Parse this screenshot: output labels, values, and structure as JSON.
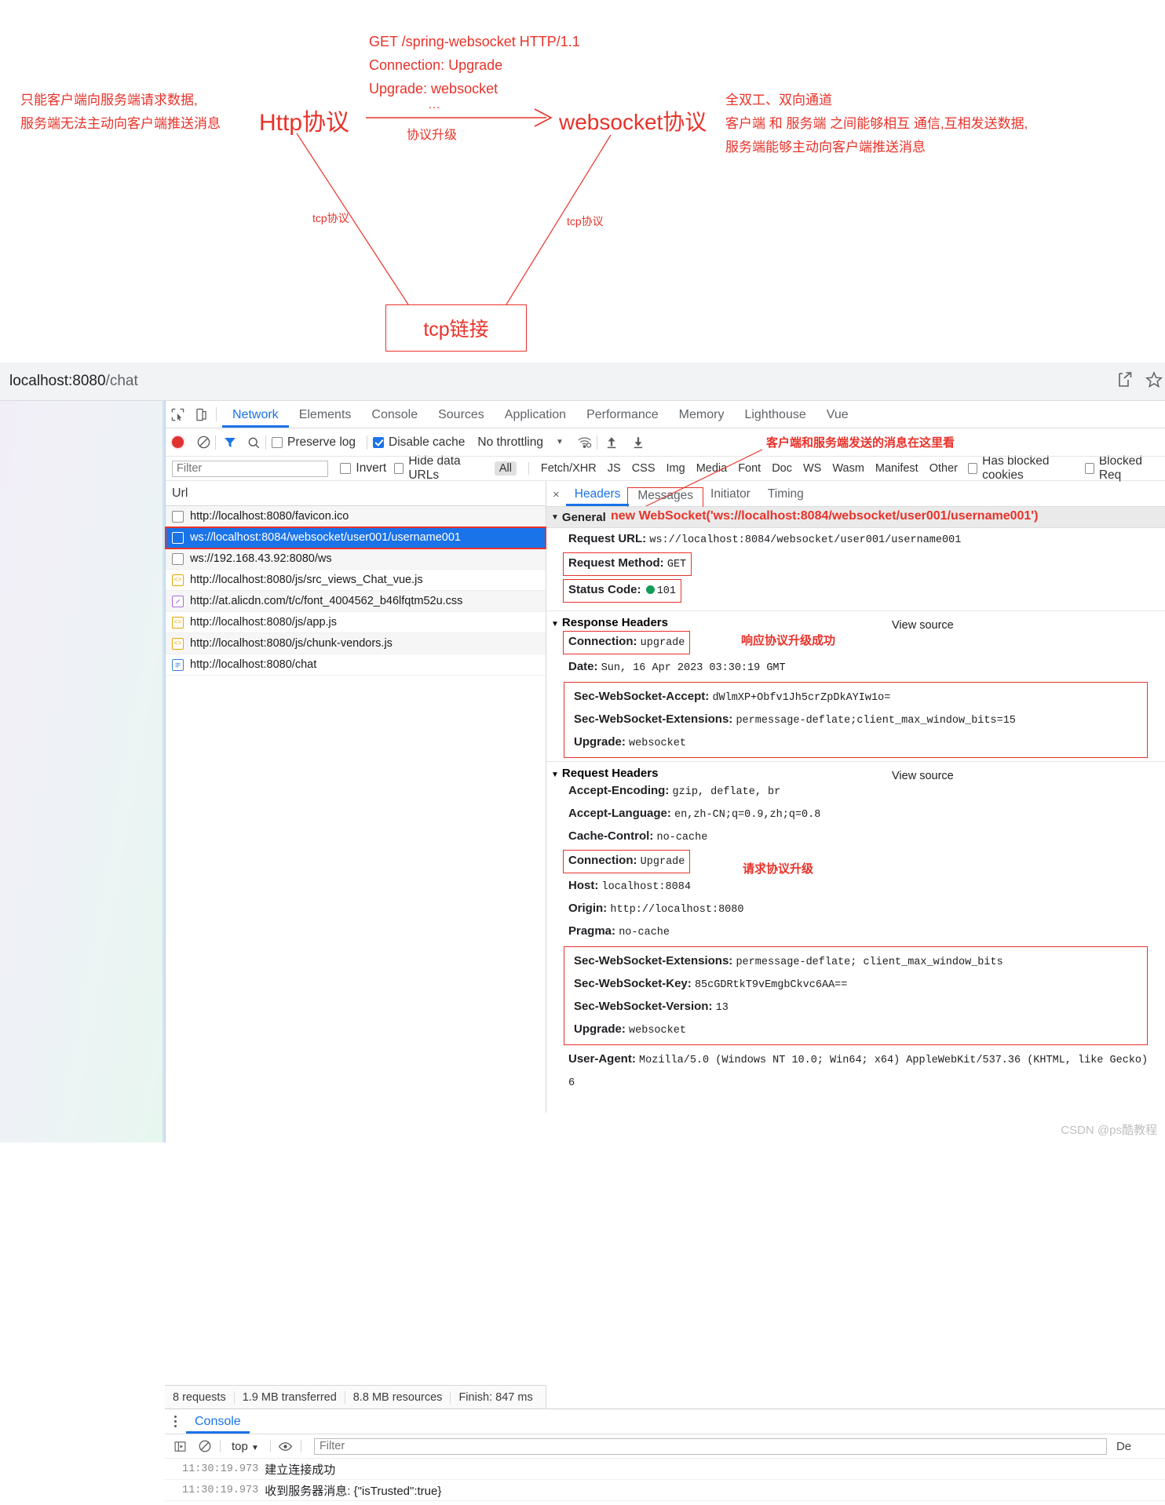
{
  "diagram": {
    "note_left_line1": "只能客户端向服务端请求数据,",
    "note_left_line2": "服务端无法主动向客户端推送消息",
    "http_label": "Http协议",
    "websocket_label": "websocket协议",
    "get_line1": "GET /spring-websocket HTTP/1.1",
    "get_line2": "Connection: Upgrade",
    "get_line3": "Upgrade: websocket",
    "arrow_dots": "…",
    "arrow_label": "协议升级",
    "note_right_line1": "全双工、双向通道",
    "note_right_line2": "客户端 和 服务端 之间能够相互 通信,互相发送数据,",
    "note_right_line3": "服务端能够主动向客户端推送消息",
    "tcp_left_label": "tcp协议",
    "tcp_right_label": "tcp协议",
    "tcp_box_label": "tcp链接",
    "accent_color": "#e8322a"
  },
  "browser": {
    "address_host": "localhost:8080",
    "address_path": "/chat"
  },
  "devtools": {
    "tabs": [
      "Network",
      "Elements",
      "Console",
      "Sources",
      "Application",
      "Performance",
      "Memory",
      "Lighthouse",
      "Vue"
    ],
    "active_tab": "Network",
    "toolbar": {
      "preserve_log": "Preserve log",
      "preserve_log_checked": false,
      "disable_cache": "Disable cache",
      "disable_cache_checked": true,
      "throttling": "No throttling"
    },
    "filterbar": {
      "filter_placeholder": "Filter",
      "filter_value": "",
      "invert": "Invert",
      "hide_data_urls": "Hide data URLs",
      "types": [
        "All",
        "Fetch/XHR",
        "JS",
        "CSS",
        "Img",
        "Media",
        "Font",
        "Doc",
        "WS",
        "Wasm",
        "Manifest",
        "Other"
      ],
      "selected_type": "All",
      "has_blocked_cookies": "Has blocked cookies",
      "blocked_requests": "Blocked Req"
    },
    "requests": {
      "column_header": "Url",
      "rows": [
        {
          "icon": "doc-blank-icon",
          "url": "http://localhost:8080/favicon.ico",
          "selected": false
        },
        {
          "icon": "doc-blank-icon",
          "url": "ws://localhost:8084/websocket/user001/username001",
          "selected": true
        },
        {
          "icon": "doc-blank-icon",
          "url": "ws://192.168.43.92:8080/ws",
          "selected": false
        },
        {
          "icon": "js-file-icon",
          "url": "http://localhost:8080/js/src_views_Chat_vue.js",
          "selected": false
        },
        {
          "icon": "css-file-icon",
          "url": "http://at.alicdn.com/t/c/font_4004562_b46lfqtm52u.css",
          "selected": false
        },
        {
          "icon": "js-file-icon",
          "url": "http://localhost:8080/js/app.js",
          "selected": false
        },
        {
          "icon": "js-file-icon",
          "url": "http://localhost:8080/js/chunk-vendors.js",
          "selected": false
        },
        {
          "icon": "document-icon",
          "url": "http://localhost:8080/chat",
          "selected": false
        }
      ]
    },
    "detail": {
      "close_label": "×",
      "tabs": [
        "Headers",
        "Messages",
        "Initiator",
        "Timing"
      ],
      "active_tab": "Headers",
      "boxed_tab": "Messages",
      "general": {
        "title": "General",
        "request_url_key": "Request URL:",
        "request_url_val": "ws://localhost:8084/websocket/user001/username001",
        "request_method_key": "Request Method:",
        "request_method_val": "GET",
        "status_code_key": "Status Code:",
        "status_code_val": "101"
      },
      "response_headers": {
        "title": "Response Headers",
        "view_source": "View source",
        "connection_key": "Connection:",
        "connection_val": "upgrade",
        "date_key": "Date:",
        "date_val": "Sun, 16 Apr 2023 03:30:19 GMT",
        "accept_key": "Sec-WebSocket-Accept:",
        "accept_val": "dWlmXP+Obfv1Jh5crZpDkAYIw1o=",
        "ext_key": "Sec-WebSocket-Extensions:",
        "ext_val": "permessage-deflate;client_max_window_bits=15",
        "upgrade_key": "Upgrade:",
        "upgrade_val": "websocket"
      },
      "request_headers": {
        "title": "Request Headers",
        "view_source": "View source",
        "accept_encoding_key": "Accept-Encoding:",
        "accept_encoding_val": "gzip, deflate, br",
        "accept_language_key": "Accept-Language:",
        "accept_language_val": "en,zh-CN;q=0.9,zh;q=0.8",
        "cache_control_key": "Cache-Control:",
        "cache_control_val": "no-cache",
        "connection_key": "Connection:",
        "connection_val": "Upgrade",
        "host_key": "Host:",
        "host_val": "localhost:8084",
        "origin_key": "Origin:",
        "origin_val": "http://localhost:8080",
        "pragma_key": "Pragma:",
        "pragma_val": "no-cache",
        "ext_key": "Sec-WebSocket-Extensions:",
        "ext_val": "permessage-deflate; client_max_window_bits",
        "key_key": "Sec-WebSocket-Key:",
        "key_val": "85cGDRtkT9vEmgbCkvc6AA==",
        "version_key": "Sec-WebSocket-Version:",
        "version_val": "13",
        "upgrade_key": "Upgrade:",
        "upgrade_val": "websocket",
        "ua_key": "User-Agent:",
        "ua_val": "Mozilla/5.0 (Windows NT 10.0; Win64; x64) AppleWebKit/537.36 (KHTML, like Gecko)",
        "ua_val2": "6"
      }
    },
    "annotations": {
      "messages_note": "客户端和服务端发送的消息在这里看",
      "new_websocket_note": "new WebSocket('ws://localhost:8084/websocket/user001/username001')",
      "response_upgrade_note": "响应协议升级成功",
      "request_upgrade_note": "请求协议升级"
    },
    "statusbar": {
      "requests": "8 requests",
      "transferred": "1.9 MB transferred",
      "resources": "8.8 MB resources",
      "finish": "Finish: 847 ms"
    },
    "drawer": {
      "tab": "Console",
      "context": "top",
      "filter_placeholder": "Filter",
      "filter_value": "",
      "default_levels": "De",
      "logs": [
        {
          "ts": "11:30:19.973",
          "msg": "建立连接成功"
        },
        {
          "ts": "11:30:19.973",
          "msg": "收到服务器消息: {\"isTrusted\":true}"
        }
      ]
    }
  },
  "watermark": "CSDN @ps酷教程"
}
